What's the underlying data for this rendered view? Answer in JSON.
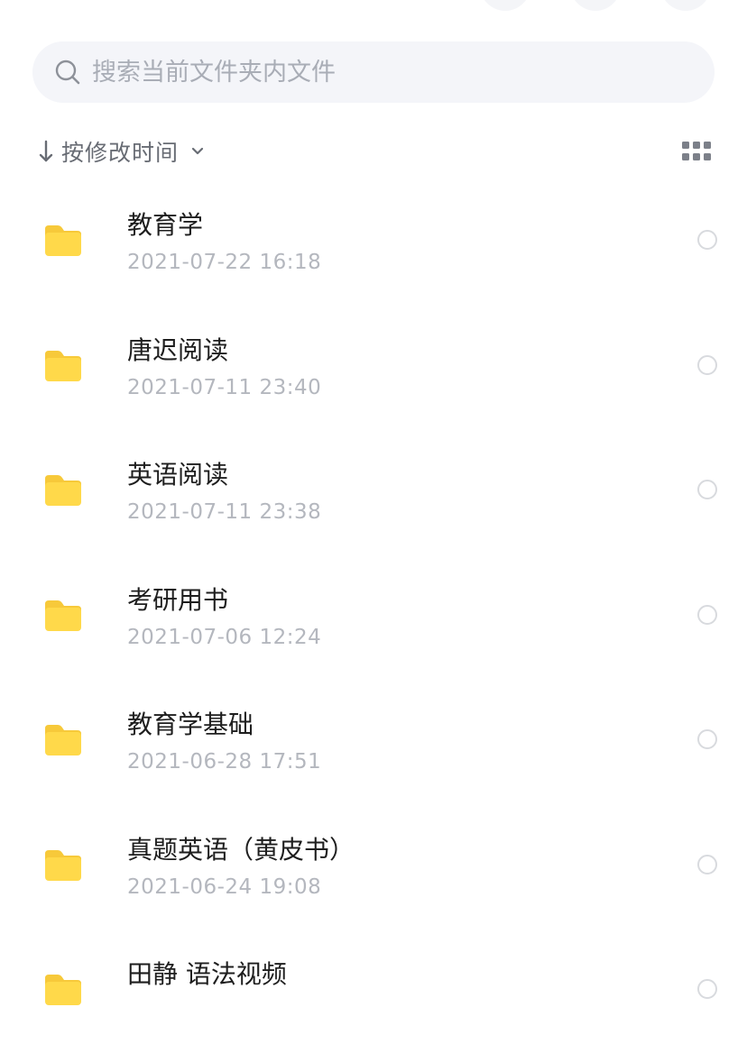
{
  "search": {
    "placeholder": "搜索当前文件夹内文件"
  },
  "sort": {
    "label": "按修改时间"
  },
  "colors": {
    "folder": "#ffd94a",
    "folder_tab": "#f7c93a",
    "search_bg": "#f4f5f9",
    "date_text": "#b4b7be",
    "icon_gray": "#8d9199"
  },
  "files": [
    {
      "name": "教育学",
      "date": "2021-07-22 16:18"
    },
    {
      "name": "唐迟阅读",
      "date": "2021-07-11 23:40"
    },
    {
      "name": "英语阅读",
      "date": "2021-07-11 23:38"
    },
    {
      "name": "考研用书",
      "date": "2021-07-06 12:24"
    },
    {
      "name": "教育学基础",
      "date": "2021-06-28 17:51"
    },
    {
      "name": "真题英语（黄皮书）",
      "date": "2021-06-24 19:08"
    },
    {
      "name": "田静 语法视频",
      "date": ""
    }
  ]
}
